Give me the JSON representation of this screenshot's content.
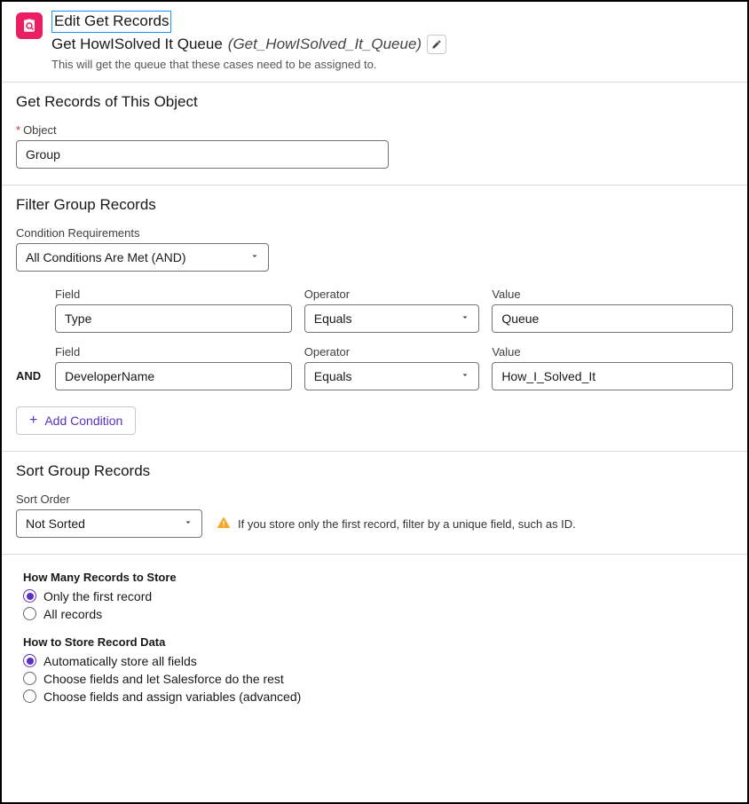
{
  "header": {
    "title": "Edit Get Records",
    "label": "Get HowISolved It Queue",
    "api_name": "(Get_HowISolved_It_Queue)",
    "description": "This will get the queue that these cases need to be assigned to."
  },
  "object_section": {
    "title": "Get Records of This Object",
    "object_label": "Object",
    "object_value": "Group"
  },
  "filter_section": {
    "title": "Filter Group Records",
    "cond_req_label": "Condition Requirements",
    "cond_req_value": "All Conditions Are Met (AND)",
    "labels": {
      "field": "Field",
      "operator": "Operator",
      "value": "Value"
    },
    "logic_operator": "AND",
    "rows": [
      {
        "field": "Type",
        "operator": "Equals",
        "value": "Queue"
      },
      {
        "field": "DeveloperName",
        "operator": "Equals",
        "value": "How_I_Solved_It"
      }
    ],
    "add_condition_label": "Add Condition"
  },
  "sort_section": {
    "title": "Sort Group Records",
    "sort_order_label": "Sort Order",
    "sort_order_value": "Not Sorted",
    "warning": "If you store only the first record, filter by a unique field, such as ID."
  },
  "store_section": {
    "how_many_heading": "How Many Records to Store",
    "how_many_options": [
      "Only the first record",
      "All records"
    ],
    "how_many_selected": 0,
    "how_store_heading": "How to Store Record Data",
    "how_store_options": [
      "Automatically store all fields",
      "Choose fields and let Salesforce do the rest",
      "Choose fields and assign variables (advanced)"
    ],
    "how_store_selected": 0
  }
}
